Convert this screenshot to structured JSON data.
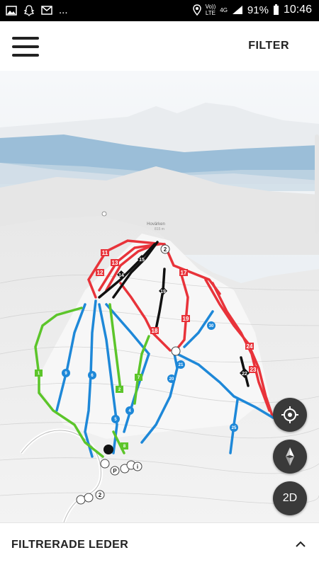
{
  "status_bar": {
    "dots": "...",
    "network_top": "Vo))",
    "network_bottom": "LTE",
    "signal_type": "4G",
    "battery_percent": "91%",
    "time": "10:46",
    "icons": [
      "image-icon",
      "snapchat-icon",
      "gmail-icon",
      "location-icon",
      "signal-icon",
      "battery-icon"
    ]
  },
  "header": {
    "menu_icon": "hamburger-menu-icon",
    "filter_label": "FILTER"
  },
  "map": {
    "peak_name": "Hovärken",
    "peak_elev": "815 m",
    "trail_numbers": {
      "red": [
        "11",
        "13",
        "12",
        "17",
        "19",
        "18",
        "24",
        "23"
      ],
      "black": [
        "15",
        "14",
        "19",
        "22"
      ],
      "blue": [
        "20",
        "21",
        "25",
        "30",
        "4",
        "5",
        "6",
        "9"
      ],
      "green": [
        "1",
        "2",
        "7",
        "8"
      ]
    },
    "poi": [
      "2",
      "P",
      "i",
      "2"
    ],
    "colors": {
      "red": "#e8333a",
      "black": "#111111",
      "blue": "#1e88d8",
      "green": "#5cc52a"
    }
  },
  "controls": {
    "locate_icon": "locate-crosshair-icon",
    "compass_icon": "compass-icon",
    "view_mode_label": "2D"
  },
  "bottom_bar": {
    "label": "FILTRERADE LEDER",
    "toggle_icon": "chevron-up-icon"
  }
}
